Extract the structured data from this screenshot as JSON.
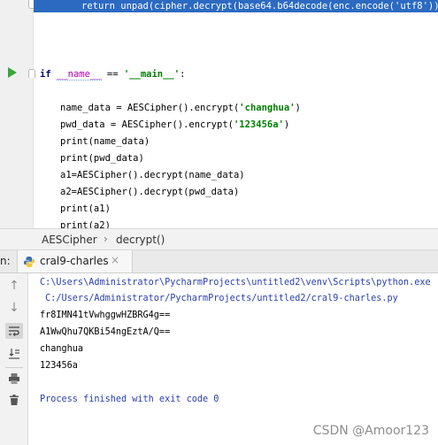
{
  "editor": {
    "line_return": "return unpad(cipher.decrypt(base64.b64decode(enc.encode('utf8'))).d",
    "if_kw": "if",
    "if_name": "__name__",
    "if_op": " == ",
    "if_main": "'__main__'",
    "if_colon": ":",
    "l1a": "name_data = AESCipher().encrypt(",
    "l1s": "'changhua'",
    "l1b": ")",
    "l2a": "pwd_data = AESCipher().encrypt(",
    "l2s": "'123456a'",
    "l2b": ")",
    "l3": "print(name_data)",
    "l4": "print(pwd_data)",
    "l5": "a1=AESCipher().decrypt(name_data)",
    "l6": "a2=AESCipher().decrypt(pwd_data)",
    "l7": "print(a1)",
    "l8": "print(a2)"
  },
  "breadcrumb": {
    "class_name": "AESCipher",
    "separator": "›",
    "method_name": "decrypt()"
  },
  "run_panel": {
    "prefix": "n:",
    "tab_label": "cral9-charles",
    "close_symbol": "×"
  },
  "console": {
    "line1": "C:\\Users\\Administrator\\PycharmProjects\\untitled2\\venv\\Scripts\\python.exe",
    "line2": " C:/Users/Administrator/PycharmProjects/untitled2/cral9-charles.py",
    "line3": "fr8IMN41tVwhggwHZBRG4g==",
    "line4": "A1WwQhu7QKBi54ngEztA/Q==",
    "line5": "changhua",
    "line6": "123456a",
    "line7": "Process finished with exit code 0"
  },
  "watermark": "CSDN @Amoor123",
  "icons": {
    "run": "run-arrow-icon",
    "python": "python-file-icon",
    "toolbar": [
      "arrow-up-icon",
      "arrow-down-icon",
      "soft-wrap-icon",
      "scroll-to-end-icon",
      "print-icon",
      "trash-icon"
    ]
  },
  "colors": {
    "keyword": "#000080",
    "string": "#008000",
    "dunder": "#b200b2",
    "selection": "#2c6ac2",
    "console_path": "#2a3fb0"
  }
}
